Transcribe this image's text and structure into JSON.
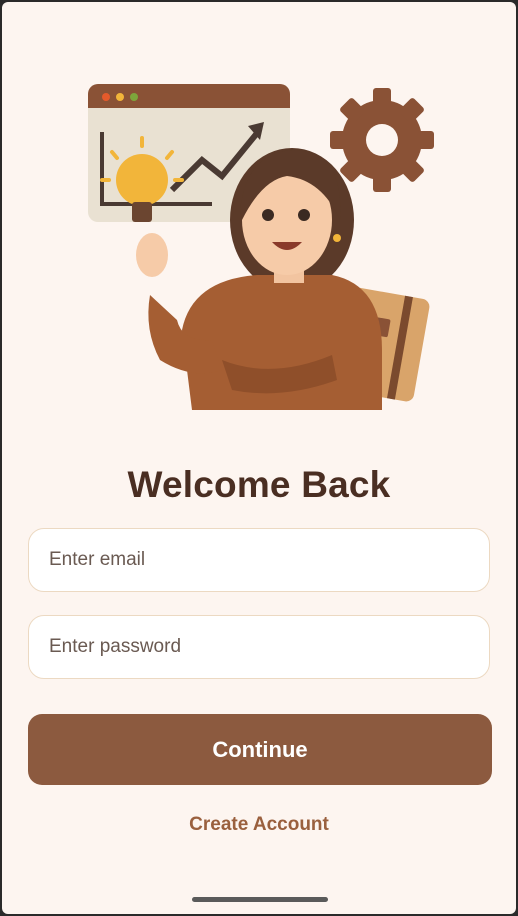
{
  "illustration": {
    "description_icon": "woman-with-lightbulb-illustration",
    "colors": {
      "sweater": "#a55e33",
      "hair": "#5b3a29",
      "bulb": "#f2b53a",
      "board": "#e9e1d2",
      "gear": "#8a5236",
      "notebook": "#d9a46a"
    }
  },
  "login": {
    "title": "Welcome Back",
    "email_placeholder": "Enter email",
    "password_placeholder": "Enter password",
    "continue_label": "Continue",
    "create_account_label": "Create Account"
  },
  "colors": {
    "background": "#fdf5f0",
    "primary": "#8c5a3f",
    "title": "#4a2e22",
    "field_border": "#ecd9c2"
  }
}
